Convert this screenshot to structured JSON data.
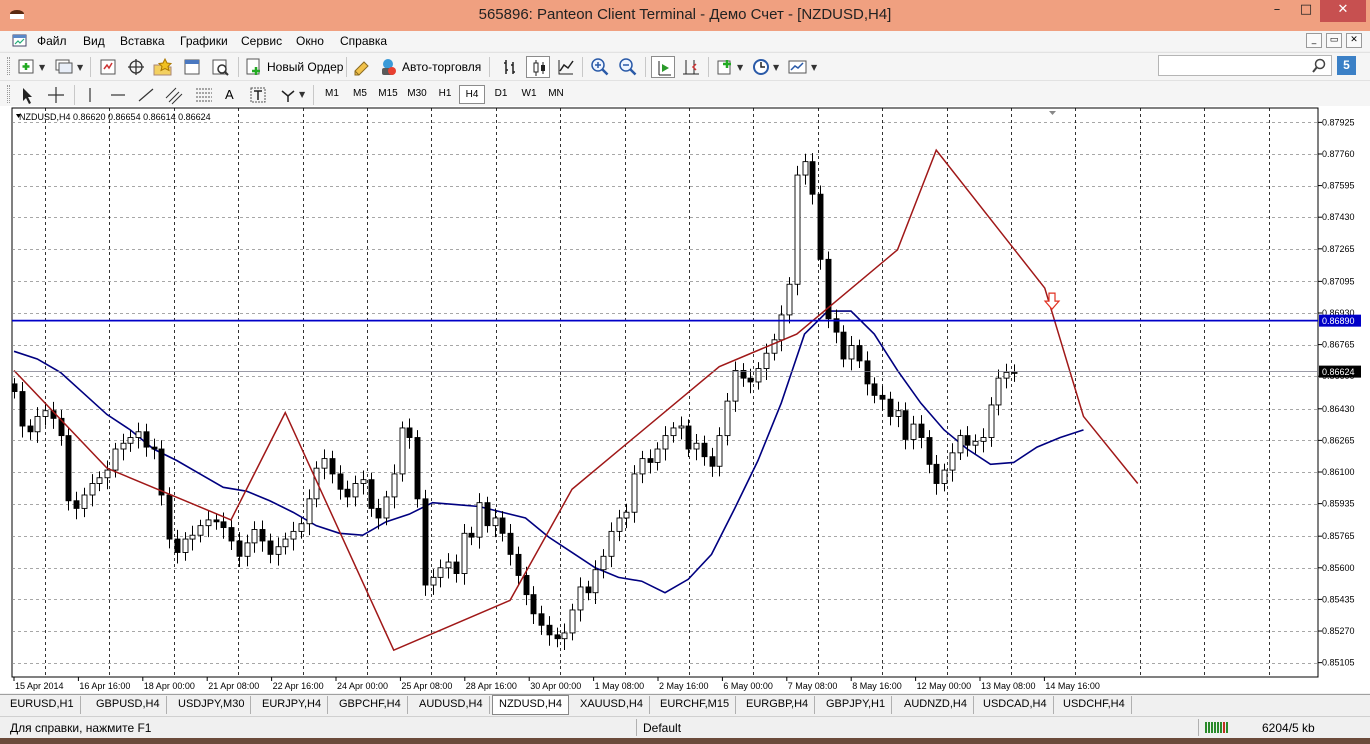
{
  "window": {
    "title": "565896: Panteon Client Terminal - Демо Счет - [NZDUSD,H4]",
    "minimize_glyph": "–",
    "restore_glyph": "□",
    "close_glyph": "✕"
  },
  "menu": {
    "items": [
      "Файл",
      "Вид",
      "Вставка",
      "Графики",
      "Сервис",
      "Окно",
      "Справка"
    ],
    "mdi_buttons": [
      "_",
      "▭",
      "✕"
    ]
  },
  "toolbar": {
    "new_order_label": "Новый Ордер",
    "autotrading_label": "Авто-торговля",
    "search_placeholder": "",
    "notify_badge": "5",
    "draw_text_tool": "A",
    "timeframes": [
      "M1",
      "M5",
      "M15",
      "M30",
      "H1",
      "H4",
      "D1",
      "W1",
      "MN"
    ],
    "active_timeframe": "H4"
  },
  "chart_data": {
    "type": "candlestick",
    "symbol_header": "NZDUSD,H4  0.86620 0.86654 0.86614 0.86624",
    "ylim": [
      0.8503,
      0.88
    ],
    "y_ticks": [
      "0.87925",
      "0.87760",
      "0.87595",
      "0.87430",
      "0.87265",
      "0.87095",
      "0.86930",
      "0.86765",
      "0.86600",
      "0.86430",
      "0.86265",
      "0.86100",
      "0.85935",
      "0.85765",
      "0.85600",
      "0.85435",
      "0.85270",
      "0.85105"
    ],
    "y_tick_values": [
      0.87925,
      0.8776,
      0.87595,
      0.8743,
      0.87265,
      0.87095,
      0.8693,
      0.86765,
      0.866,
      0.8643,
      0.86265,
      0.861,
      0.85935,
      0.85765,
      0.856,
      0.85435,
      0.8527,
      0.85105
    ],
    "x_labels": [
      "15 Apr 2014",
      "16 Apr 16:00",
      "18 Apr 00:00",
      "21 Apr 08:00",
      "22 Apr 16:00",
      "24 Apr 00:00",
      "25 Apr 08:00",
      "28 Apr 16:00",
      "30 Apr 00:00",
      "1 May 08:00",
      "2 May 16:00",
      "6 May 00:00",
      "7 May 08:00",
      "8 May 16:00",
      "12 May 00:00",
      "13 May 08:00",
      "14 May 16:00"
    ],
    "candle_count": 130,
    "closes": [
      0.8652,
      0.8634,
      0.8631,
      0.8639,
      0.8642,
      0.8638,
      0.8629,
      0.8595,
      0.8591,
      0.8598,
      0.8604,
      0.8607,
      0.8611,
      0.8622,
      0.8625,
      0.8628,
      0.8631,
      0.8623,
      0.8622,
      0.8598,
      0.8575,
      0.8568,
      0.8575,
      0.8577,
      0.8582,
      0.8585,
      0.8584,
      0.8581,
      0.8574,
      0.8566,
      0.8573,
      0.858,
      0.8574,
      0.8567,
      0.8571,
      0.8575,
      0.8579,
      0.8583,
      0.8596,
      0.8612,
      0.8617,
      0.8609,
      0.8601,
      0.8597,
      0.8604,
      0.8606,
      0.8591,
      0.8586,
      0.8597,
      0.8609,
      0.8633,
      0.8628,
      0.8596,
      0.8551,
      0.8555,
      0.856,
      0.8563,
      0.8557,
      0.8578,
      0.8576,
      0.8594,
      0.8582,
      0.8586,
      0.8578,
      0.8567,
      0.8556,
      0.8546,
      0.8536,
      0.853,
      0.8525,
      0.8523,
      0.8526,
      0.8538,
      0.855,
      0.8547,
      0.8559,
      0.8566,
      0.8579,
      0.8586,
      0.8589,
      0.8609,
      0.8617,
      0.8615,
      0.8622,
      0.8629,
      0.8633,
      0.8634,
      0.8622,
      0.8625,
      0.8618,
      0.8613,
      0.8629,
      0.8647,
      0.8663,
      0.8659,
      0.8657,
      0.8664,
      0.8672,
      0.8679,
      0.8692,
      0.8708,
      0.8765,
      0.8772,
      0.8755,
      0.8721,
      0.869,
      0.8683,
      0.8669,
      0.8676,
      0.8668,
      0.8656,
      0.865,
      0.8648,
      0.8639,
      0.8642,
      0.8627,
      0.8635,
      0.8628,
      0.8614,
      0.8604,
      0.8611,
      0.862,
      0.8629,
      0.8624,
      0.8626,
      0.8628,
      0.8645,
      0.8659,
      0.8662,
      0.8662
    ],
    "series": [
      {
        "name": "",
        "values": [
          0.8673,
          0.8669,
          0.8662,
          0.8651,
          0.864,
          0.8632,
          0.8622,
          0.8616,
          0.8609,
          0.8602,
          0.86,
          0.8595,
          0.8589,
          0.8582,
          0.8578,
          0.8577,
          0.8584,
          0.8588,
          0.8594,
          0.8593,
          0.8592,
          0.8589,
          0.8586,
          0.8576,
          0.8568,
          0.856,
          0.8555,
          0.8553,
          0.8547,
          0.8554,
          0.8567,
          0.8591,
          0.8616,
          0.8646,
          0.8682,
          0.8694,
          0.8694,
          0.8682,
          0.8663,
          0.8646,
          0.8632,
          0.8622,
          0.8614,
          0.8615,
          0.8623,
          0.8628,
          0.8632
        ]
      },
      {
        "name": "",
        "values": [
          0.8663,
          0.8612,
          0.8585,
          0.8641,
          0.8517,
          0.8543,
          0.8601,
          0.8665,
          0.8682,
          0.8726,
          0.8778,
          0.8706,
          0.8639,
          0.8604,
          0.8671
        ]
      }
    ],
    "sma_x_index": [
      0,
      3,
      6,
      9,
      12,
      15,
      18,
      21,
      24,
      27,
      30,
      33,
      36,
      39,
      42,
      45,
      48,
      51,
      54,
      57,
      60,
      63,
      66,
      69,
      72,
      75,
      78,
      81,
      84,
      87,
      90,
      93,
      96,
      99,
      102,
      105,
      108,
      111,
      114,
      117,
      120,
      123,
      126,
      129,
      132,
      135,
      138
    ],
    "zigzag_x_index": [
      0,
      12,
      28,
      35,
      49,
      64,
      72,
      91,
      101,
      114,
      119,
      133,
      138,
      145
    ],
    "hline_level": 0.8689,
    "hline_label": "0.86890",
    "bid_level": 0.86624,
    "bid_label": "0.86624",
    "sell_arrow_level": 0.8695,
    "grid": true
  },
  "tabs": {
    "items": [
      "EURUSD,H1",
      "GBPUSD,H4",
      "USDJPY,M30",
      "EURJPY,H4",
      "GBPCHF,H4",
      "AUDUSD,H4",
      "NZDUSD,H4",
      "XAUUSD,H4",
      "EURCHF,M15",
      "EURGBP,H4",
      "GBPJPY,H1",
      "AUDNZD,H4",
      "USDCAD,H4",
      "USDCHF,H4"
    ],
    "active": "NZDUSD,H4"
  },
  "status": {
    "help_text": "Для справки, нажмите F1",
    "profile": "Default",
    "traffic": "6204/5 kb"
  },
  "colors": {
    "titlebar": "#f0a080",
    "bull_candle": "#ffffff",
    "bear_candle": "#000000",
    "hline": "#0000c8",
    "zigzag": "#a01818",
    "sma": "#000080",
    "sell_arrow": "#e03020"
  }
}
